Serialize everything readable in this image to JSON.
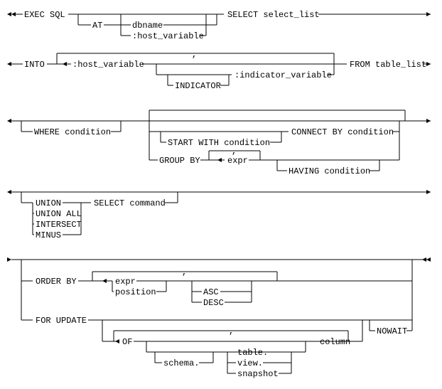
{
  "diagram": {
    "type": "syntax_railroad",
    "statement": "EXEC SQL SELECT (embedded SQL)",
    "tokens": {
      "exec_sql": "EXEC SQL",
      "at": "AT",
      "dbname": "dbname",
      "host_variable": ":host_variable",
      "select": "SELECT select_list",
      "into": "INTO",
      "into_host": ":host_variable",
      "indicator": "INDICATOR",
      "indicator_var": ":indicator_variable",
      "from": "FROM table_list",
      "where": "WHERE condition",
      "start_with": "START WITH condition",
      "connect_by": "CONNECT BY condition",
      "group_by": "GROUP BY",
      "expr": "expr",
      "having": "HAVING condition",
      "union": "UNION",
      "union_all": "UNION ALL",
      "intersect": "INTERSECT",
      "minus": "MINUS",
      "select_cmd": "SELECT command",
      "order_by": "ORDER BY",
      "position": "position",
      "asc": "ASC",
      "desc": "DESC",
      "for_update": "FOR UPDATE",
      "of": "OF",
      "schema": "schema.",
      "table": "table.",
      "view": "view.",
      "snapshot": "snapshot",
      "column": "column",
      "nowait": "NOWAIT",
      "comma": ","
    }
  }
}
